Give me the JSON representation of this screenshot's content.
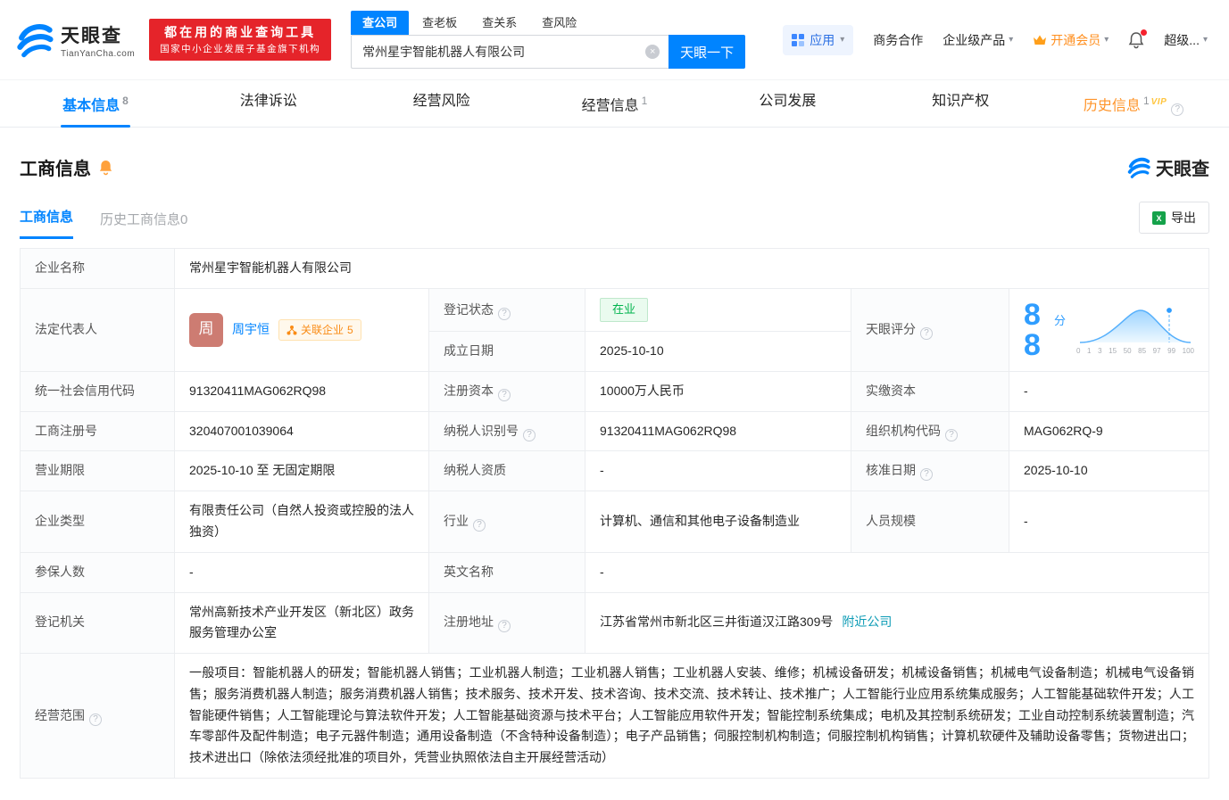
{
  "icons": {
    "question": "?",
    "caret": "▾",
    "clear": "×"
  },
  "header": {
    "logo_title": "天眼查",
    "logo_subtitle": "TianYanCha.com",
    "banner_line1": "都在用的商业查询工具",
    "banner_line2": "国家中小企业发展子基金旗下机构",
    "search_tabs": [
      {
        "label": "查公司"
      },
      {
        "label": "查老板"
      },
      {
        "label": "查关系"
      },
      {
        "label": "查风险"
      }
    ],
    "search_value": "常州星宇智能机器人有限公司",
    "search_button": "天眼一下",
    "nav": {
      "apps": "应用",
      "cooperation": "商务合作",
      "enterprise": "企业级产品",
      "membership": "开通会员",
      "user": "超级..."
    }
  },
  "tabs": [
    {
      "label": "基本信息",
      "badge": "8"
    },
    {
      "label": "法律诉讼",
      "badge": ""
    },
    {
      "label": "经营风险",
      "badge": ""
    },
    {
      "label": "经营信息",
      "badge": "1"
    },
    {
      "label": "公司发展",
      "badge": ""
    },
    {
      "label": "知识产权",
      "badge": ""
    },
    {
      "label": "历史信息",
      "badge": "1",
      "vip": "VIP"
    }
  ],
  "section": {
    "title": "工商信息",
    "brand": "天眼查",
    "subtab_active": "工商信息",
    "subtab_history": "历史工商信息",
    "subtab_history_count": "0",
    "export_label": "导出"
  },
  "fields": {
    "company_name": {
      "label": "企业名称",
      "value": "常州星宇智能机器人有限公司"
    },
    "legal_rep": {
      "label": "法定代表人",
      "avatar": "周",
      "name": "周宇恒",
      "related": "关联企业",
      "related_count": "5"
    },
    "reg_status": {
      "label": "登记状态",
      "value": "在业"
    },
    "establish_date": {
      "label": "成立日期",
      "value": "2025-10-10"
    },
    "score": {
      "label": "天眼评分",
      "value": "88",
      "unit": "分"
    },
    "credit_code": {
      "label": "统一社会信用代码",
      "value": "91320411MAG062RQ98"
    },
    "reg_capital": {
      "label": "注册资本",
      "value": "10000万人民币"
    },
    "paid_capital": {
      "label": "实缴资本",
      "value": "-"
    },
    "reg_number": {
      "label": "工商注册号",
      "value": "320407001039064"
    },
    "taxpayer_id": {
      "label": "纳税人识别号",
      "value": "91320411MAG062RQ98"
    },
    "org_code": {
      "label": "组织机构代码",
      "value": "MAG062RQ-9"
    },
    "business_term": {
      "label": "营业期限",
      "value": "2025-10-10 至 无固定期限"
    },
    "taxpayer_quality": {
      "label": "纳税人资质",
      "value": "-"
    },
    "approval_date": {
      "label": "核准日期",
      "value": "2025-10-10"
    },
    "company_type": {
      "label": "企业类型",
      "value": "有限责任公司（自然人投资或控股的法人独资）"
    },
    "industry": {
      "label": "行业",
      "value": "计算机、通信和其他电子设备制造业"
    },
    "staff_size": {
      "label": "人员规模",
      "value": "-"
    },
    "insured_count": {
      "label": "参保人数",
      "value": "-"
    },
    "english_name": {
      "label": "英文名称",
      "value": "-"
    },
    "registry": {
      "label": "登记机关",
      "value": "常州高新技术产业开发区（新北区）政务服务管理办公室"
    },
    "address": {
      "label": "注册地址",
      "value": "江苏省常州市新北区三井街道汉江路309号",
      "link": "附近公司"
    },
    "business_scope": {
      "label": "经营范围",
      "value": "一般项目：智能机器人的研发；智能机器人销售；工业机器人制造；工业机器人销售；工业机器人安装、维修；机械设备研发；机械设备销售；机械电气设备制造；机械电气设备销售；服务消费机器人制造；服务消费机器人销售；技术服务、技术开发、技术咨询、技术交流、技术转让、技术推广；人工智能行业应用系统集成服务；人工智能基础软件开发；人工智能硬件销售；人工智能理论与算法软件开发；人工智能基础资源与技术平台；人工智能应用软件开发；智能控制系统集成；电机及其控制系统研发；工业自动控制系统装置制造；汽车零部件及配件制造；电子元器件制造；通用设备制造（不含特种设备制造）；电子产品销售；伺服控制机构制造；伺服控制机构销售；计算机软硬件及辅助设备零售；货物进出口；技术进出口（除依法须经批准的项目外，凭营业执照依法自主开展经营活动）"
    }
  },
  "score_axis": [
    "0",
    "1",
    "3",
    "15",
    "50",
    "85",
    "97",
    "99",
    "100"
  ]
}
